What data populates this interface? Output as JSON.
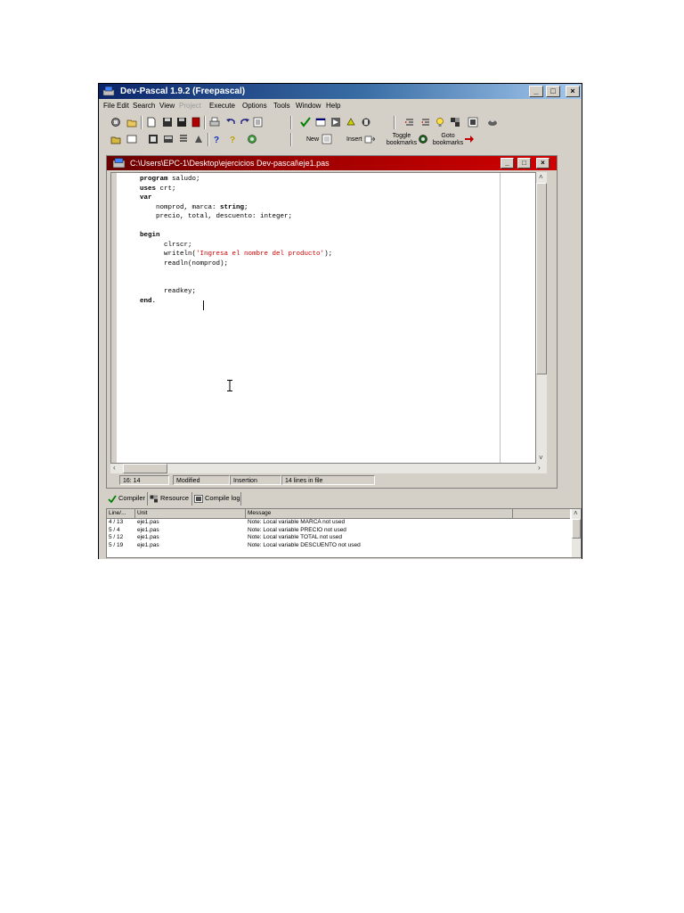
{
  "window": {
    "title": "Dev-Pascal 1.9.2 (Freepascal)",
    "minimize": "_",
    "maximize": "□",
    "close": "×"
  },
  "menu": {
    "items": [
      {
        "label": "File",
        "disabled": false
      },
      {
        "label": "Edit",
        "disabled": false
      },
      {
        "label": "Search",
        "disabled": false
      },
      {
        "label": "View",
        "disabled": false
      },
      {
        "label": "Project",
        "disabled": true
      },
      {
        "label": "Execute",
        "disabled": false
      },
      {
        "label": "Options",
        "disabled": false
      },
      {
        "label": "Tools",
        "disabled": false
      },
      {
        "label": "Window",
        "disabled": false
      },
      {
        "label": "Help",
        "disabled": false
      }
    ]
  },
  "toolbar": {
    "new_label": "New",
    "insert_label": "Insert",
    "toggle_bookmarks_label": "Toggle bookmarks",
    "goto_bookmarks_label": "Goto bookmarks"
  },
  "editor": {
    "title": "C:\\Users\\EPC-1\\Desktop\\ejercicios Dev-pascal\\eje1.pas",
    "code_lines": [
      {
        "indent": 0,
        "parts": [
          {
            "t": "program",
            "k": "kw"
          },
          {
            "t": " saludo;",
            "k": ""
          }
        ]
      },
      {
        "indent": 0,
        "parts": [
          {
            "t": "uses",
            "k": "kw"
          },
          {
            "t": " crt;",
            "k": ""
          }
        ]
      },
      {
        "indent": 0,
        "parts": [
          {
            "t": "var",
            "k": "kw"
          }
        ]
      },
      {
        "indent": 2,
        "parts": [
          {
            "t": "nomprod, marca: ",
            "k": ""
          },
          {
            "t": "string",
            "k": "kw"
          },
          {
            "t": ";",
            "k": ""
          }
        ]
      },
      {
        "indent": 2,
        "parts": [
          {
            "t": "precio, total, descuento: integer;",
            "k": ""
          }
        ]
      },
      {
        "indent": 0,
        "parts": [
          {
            "t": "",
            "k": ""
          }
        ]
      },
      {
        "indent": 0,
        "parts": [
          {
            "t": "begin",
            "k": "kw"
          }
        ]
      },
      {
        "indent": 3,
        "parts": [
          {
            "t": "clrscr;",
            "k": ""
          }
        ]
      },
      {
        "indent": 3,
        "parts": [
          {
            "t": "writeln(",
            "k": ""
          },
          {
            "t": "'Ingresa el nombre del producto'",
            "k": "str"
          },
          {
            "t": ");",
            "k": ""
          }
        ]
      },
      {
        "indent": 3,
        "parts": [
          {
            "t": "readln(nomprod);",
            "k": ""
          }
        ]
      },
      {
        "indent": 0,
        "parts": [
          {
            "t": "",
            "k": ""
          }
        ]
      },
      {
        "indent": 0,
        "parts": [
          {
            "t": "",
            "k": ""
          }
        ]
      },
      {
        "indent": 3,
        "parts": [
          {
            "t": "readkey;",
            "k": ""
          }
        ]
      },
      {
        "indent": 0,
        "parts": [
          {
            "t": "end.",
            "k": "kw"
          }
        ]
      }
    ]
  },
  "status": {
    "position": "16: 14",
    "modified": "Modified",
    "mode": "Insertion",
    "lines": "14 lines in file"
  },
  "bottom_tabs": [
    {
      "label": "Compiler",
      "icon": "check-icon"
    },
    {
      "label": "Resource",
      "icon": "resource-icon"
    },
    {
      "label": "Compile log",
      "icon": "log-icon"
    }
  ],
  "messages": {
    "headers": [
      "Line/...",
      "Unit",
      "Message"
    ],
    "rows": [
      [
        "4 / 13",
        "eje1.pas",
        "Note: Local variable MARCA not used"
      ],
      [
        "5 / 4",
        "eje1.pas",
        "Note: Local variable PRECIO not used"
      ],
      [
        "5 / 12",
        "eje1.pas",
        "Note: Local variable TOTAL not used"
      ],
      [
        "5 / 19",
        "eje1.pas",
        "Note: Local variable DESCUENTO not used"
      ]
    ]
  },
  "colors": {
    "title_blue": "#0a246a",
    "child_title_red": "#a00000",
    "face": "#d4d0c8",
    "string_red": "#d00000"
  }
}
